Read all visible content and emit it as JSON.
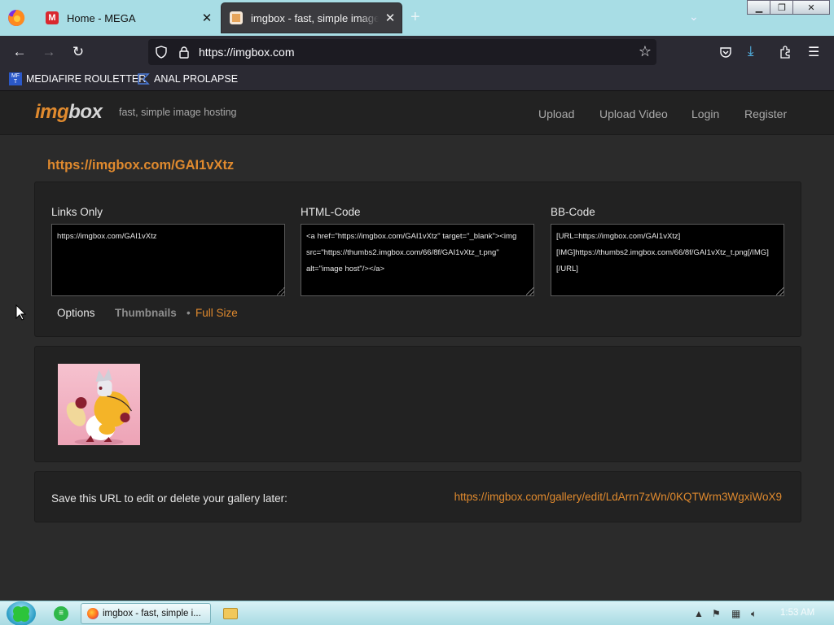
{
  "browser": {
    "tabs": [
      {
        "label": "Home - MEGA"
      },
      {
        "label": "imgbox - fast, simple image hosting"
      }
    ],
    "url": "https://imgbox.com",
    "bookmarks": [
      {
        "label": "MEDIAFIRE ROULETTER",
        "icon_text": "MF\nT"
      },
      {
        "label": "ANAL PROLAPSE"
      }
    ],
    "colors": {
      "tabbar": "#a8dde5",
      "toolbar": "#2b2a33",
      "accent_download": "#54b8ec"
    }
  },
  "site": {
    "logo_part1": "img",
    "logo_part2": "box",
    "tagline": "fast, simple image hosting",
    "nav": [
      "Upload",
      "Upload Video",
      "Login",
      "Register"
    ],
    "accent": "#e08a2e"
  },
  "main": {
    "title_url": "https://imgbox.com/GAI1vXtz",
    "links_label": "Links Only",
    "links_value": "https://imgbox.com/GAI1vXtz",
    "html_label": "HTML-Code",
    "html_value": "<a href=\"https://imgbox.com/GAI1vXtz\" target=\"_blank\"><img src=\"https://thumbs2.imgbox.com/66/8f/GAI1vXtz_t.png\" alt=\"image host\"/></a>",
    "bb_label": "BB-Code",
    "bb_value": "[URL=https://imgbox.com/GAI1vXtz][IMG]https://thumbs2.imgbox.com/66/8f/GAI1vXtz_t.png[/IMG][/URL]",
    "options_label": "Options",
    "thumbnails_label": "Thumbnails",
    "separator": "•",
    "fullsize_label": "Full Size",
    "save_text": "Save this URL to edit or delete your gallery later:",
    "gallery_url": "https://imgbox.com/gallery/edit/LdArrn7zWn/0KQTWrm3WgxiWoX9"
  },
  "taskbar": {
    "task_label": "imgbox - fast, simple i...",
    "clock": "1:53 AM"
  }
}
